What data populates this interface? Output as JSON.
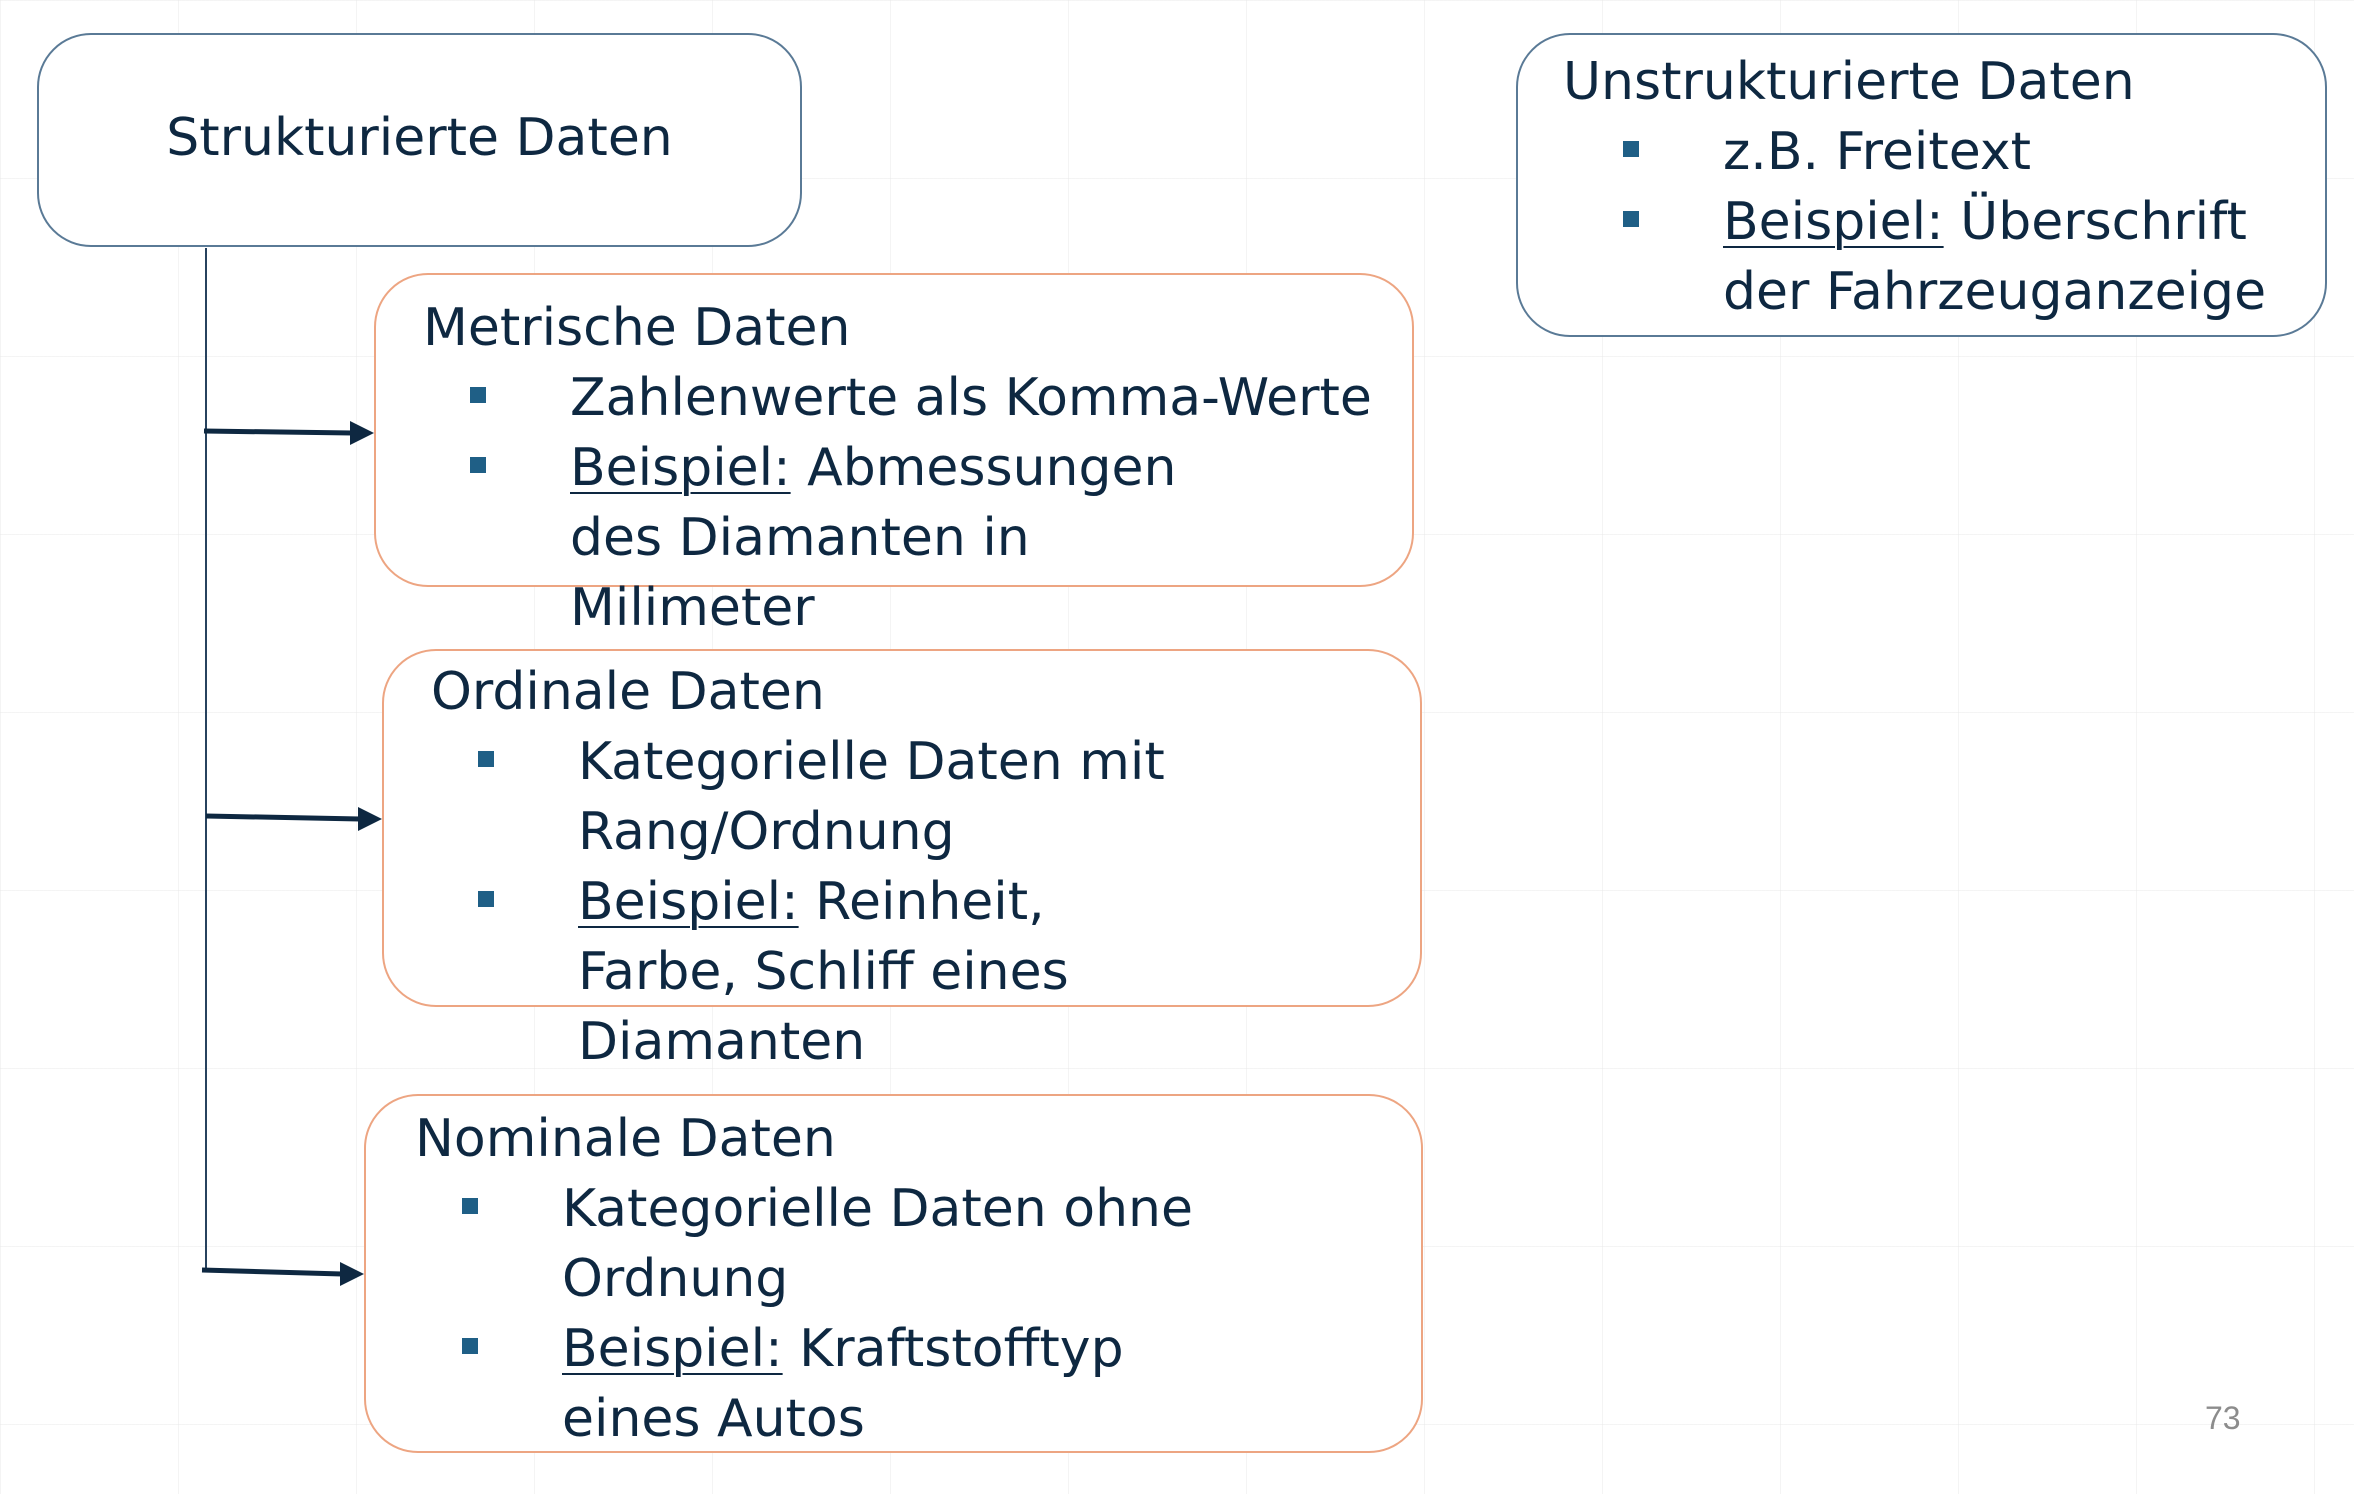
{
  "structured": {
    "title": "Strukturierte Daten"
  },
  "unstructured": {
    "title": "Unstrukturierte Daten",
    "bullets": [
      {
        "label": "",
        "text": "z.B. Freitext"
      },
      {
        "label": "Beispiel:",
        "text": " Überschrift der Fahrzeuganzeige"
      }
    ]
  },
  "metric": {
    "title": "Metrische Daten",
    "bullets": [
      {
        "label": "",
        "text": "Zahlenwerte als Komma-Werte"
      },
      {
        "label": "Beispiel:",
        "text": " Abmessungen des Diamanten in Milimeter"
      }
    ]
  },
  "ordinal": {
    "title": "Ordinale Daten",
    "bullets": [
      {
        "label": "",
        "text": "Kategorielle Daten mit Rang/Ordnung"
      },
      {
        "label": "Beispiel:",
        "text": " Reinheit, Farbe, Schliff eines Diamanten"
      }
    ]
  },
  "nominal": {
    "title": "Nominale Daten",
    "bullets": [
      {
        "label": "",
        "text": "Kategorielle Daten ohne Ordnung"
      },
      {
        "label": "Beispiel:",
        "text": " Kraftstofftyp eines Autos"
      }
    ]
  },
  "page_number": "73",
  "colors": {
    "text": "#0e2841",
    "bullet": "#1f5f86",
    "blue_border": "#5a7a96",
    "orange_border": "#eda582"
  }
}
